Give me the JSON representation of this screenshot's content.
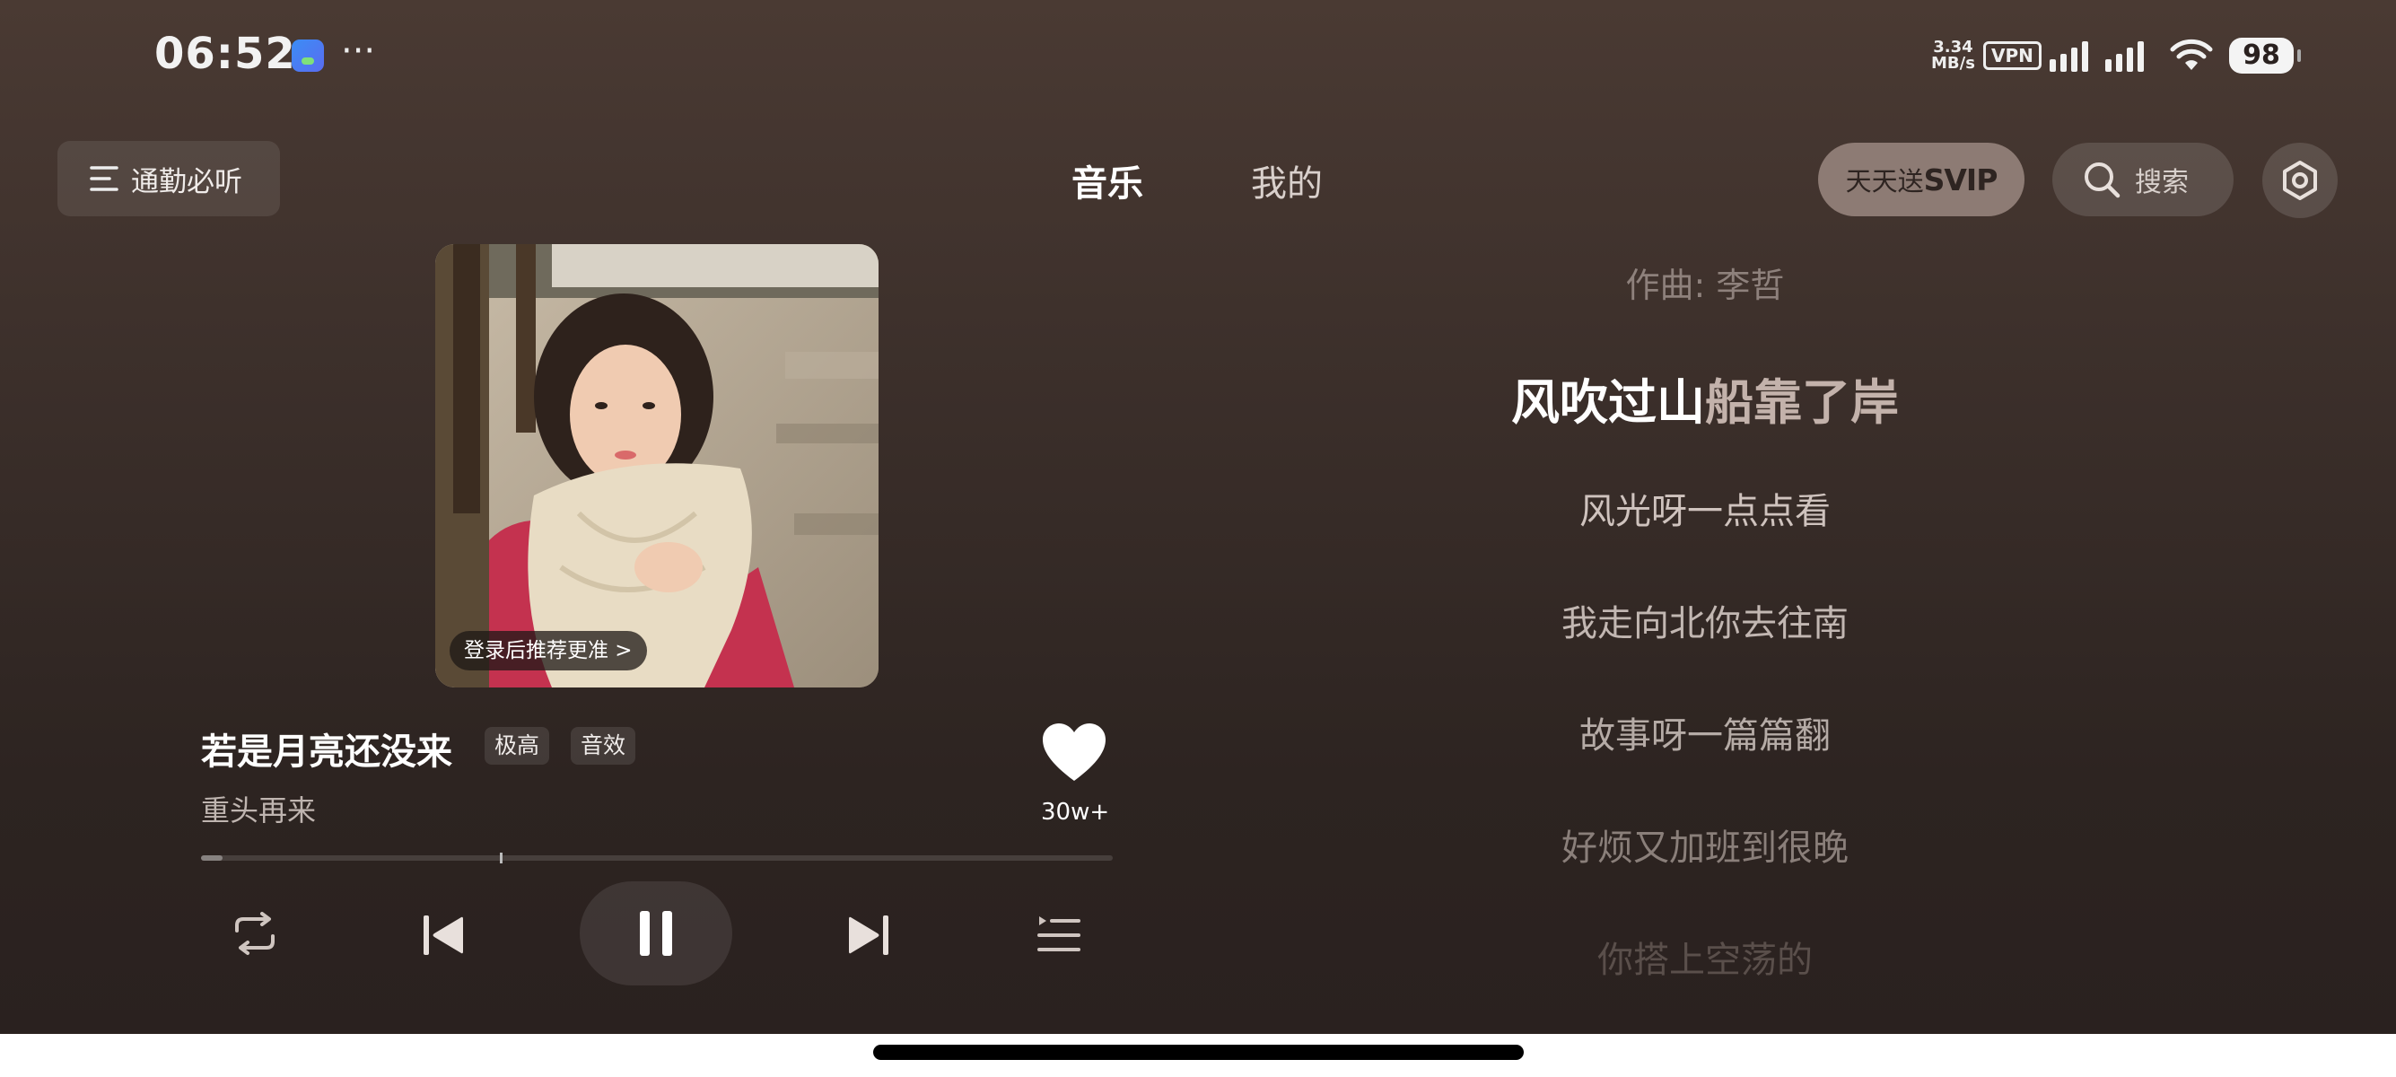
{
  "status_bar": {
    "time": "06:52",
    "more": "···",
    "net_speed_value": "3.34",
    "net_speed_unit": "MB/s",
    "vpn": "VPN",
    "battery": "98"
  },
  "header": {
    "playlist_label": "通勤必听",
    "tabs": [
      {
        "label": "音乐",
        "active": true
      },
      {
        "label": "我的",
        "active": false
      }
    ],
    "promo_prefix": "天天送",
    "promo_svip": "SVIP",
    "search_label": "搜索"
  },
  "player": {
    "login_tip": "登录后推荐更准 >",
    "song_title": "若是月亮还没来",
    "quality_badge": "极高",
    "effect_badge": "音效",
    "artist": "重头再来",
    "like_count": "30w+",
    "progress": 0.024
  },
  "lyrics": {
    "credit": "作曲: 李哲",
    "active_sung": "风吹过山",
    "active_unsung": "船靠了岸",
    "lines": [
      "风光呀一点点看",
      "我走向北你去往南",
      "故事呀一篇篇翻",
      "好烦又加班到很晚",
      "你搭上空荡的"
    ]
  },
  "colors": {
    "background_top": "#4a3a33",
    "background_bottom": "#2a211f",
    "svip_pill": "#8d7b74"
  }
}
